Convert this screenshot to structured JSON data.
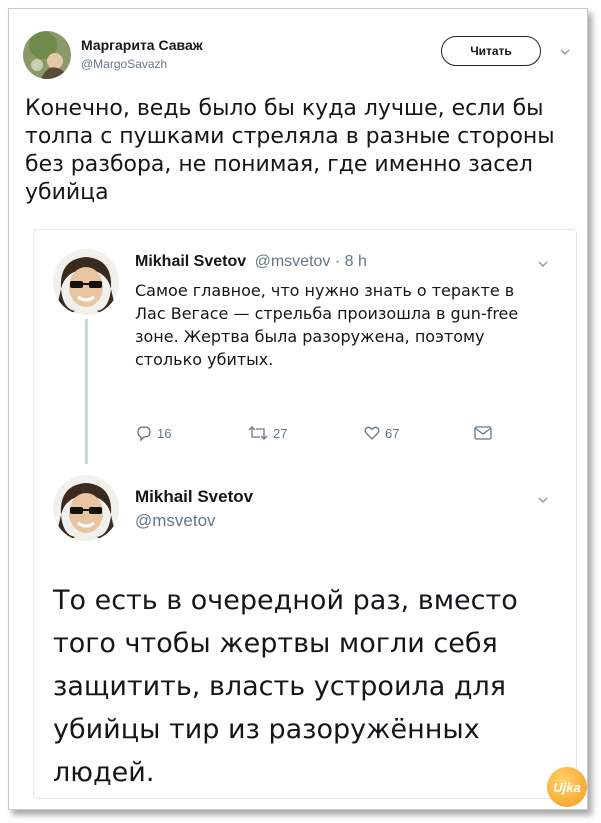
{
  "tweet": {
    "author_name": "Маргарита Саваж",
    "author_handle": "@MargoSavazh",
    "follow_label": "Читать",
    "text": "Конечно, ведь было бы куда лучше, если бы толпа с пушками стреляла в разные стороны без разбора, не понимая, где именно засел убийца"
  },
  "quoted_tweet": {
    "author_name": "Mikhail Svetov",
    "author_handle": "@msvetov",
    "separator": "·",
    "time": "8 h",
    "text": "Самое главное, что нужно знать о теракте в Лас Вегасе — стрельба произошла в gun-free зоне. Жертва была разоружена, поэтому столько убитых.",
    "replies": "16",
    "retweets": "27",
    "likes": "67"
  },
  "reply_tweet": {
    "author_name": "Mikhail Svetov",
    "author_handle": "@msvetov",
    "text": "То есть в очередной раз, вместо того чтобы жертвы могли себя защитить, власть устроила для убийцы тир из разоружённых людей."
  },
  "watermark": {
    "text": "Ujka"
  },
  "icons": [
    "chevron-down-icon",
    "reply-icon",
    "retweet-icon",
    "like-icon",
    "message-icon"
  ],
  "colors": {
    "text": "#14171a",
    "secondary": "#657786",
    "border": "#e1e8ed",
    "thread": "#ccd6dd",
    "watermark": "#f39a1d"
  }
}
